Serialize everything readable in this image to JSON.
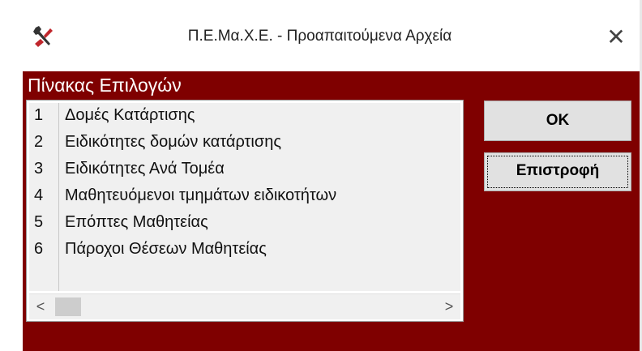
{
  "window": {
    "title": "Π.Ε.Μα.Χ.Ε. - Προαπαιτούμενα Αρχεία",
    "close_symbol": "✕",
    "app_icon": "tools-icon"
  },
  "panel": {
    "title": "Πίνακας Επιλογών",
    "background_color": "#7f0000"
  },
  "list": {
    "items": [
      {
        "num": "1",
        "label": "Δομές Κατάρτισης"
      },
      {
        "num": "2",
        "label": "Ειδικότητες δομών κατάρτισης"
      },
      {
        "num": "3",
        "label": "Ειδικότητες Ανά Τομέα"
      },
      {
        "num": "4",
        "label": "Μαθητευόμενοι τμημάτων ειδικοτήτων"
      },
      {
        "num": "5",
        "label": "Επόπτες Μαθητείας"
      },
      {
        "num": "6",
        "label": "Πάροχοι Θέσεων Μαθητείας"
      }
    ],
    "scroll_left": "<",
    "scroll_right": ">"
  },
  "buttons": {
    "ok_label": "OK",
    "back_label": "Επιστροφή"
  }
}
